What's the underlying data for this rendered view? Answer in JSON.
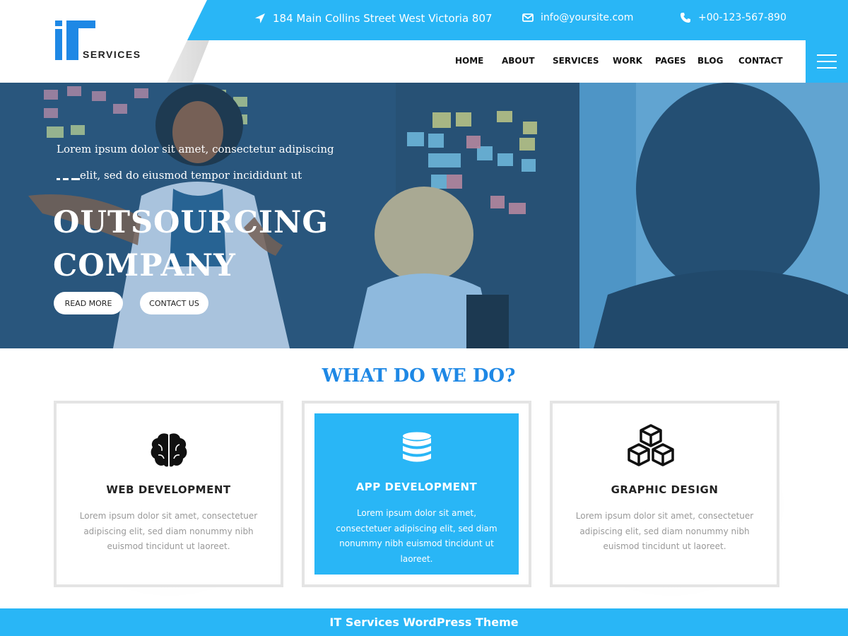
{
  "brand": {
    "logo_letters": "iT",
    "logo_text": "SERVICES"
  },
  "topbar": {
    "address": "184 Main Collins Street West Victoria 807",
    "email": "info@yoursite.com",
    "phone": "+00-123-567-890"
  },
  "nav": {
    "items": [
      "HOME",
      "ABOUT",
      "SERVICES",
      "WORK",
      "PAGES",
      "BLOG",
      "CONTACT"
    ]
  },
  "hero": {
    "subtitle_line1": "Lorem ipsum dolor sit amet, consectetur adipiscing",
    "subtitle_line2": "elit, sed do eiusmod tempor incididunt ut",
    "title_line1": "OUTSOURCING",
    "title_line2": "COMPANY",
    "read_more": "READ MORE",
    "contact_us": "CONTACT US"
  },
  "services": {
    "heading": "WHAT DO WE DO?",
    "cards": [
      {
        "icon": "brain-icon",
        "title": "WEB DEVELOPMENT",
        "text": "Lorem ipsum dolor sit amet, consectetuer adipiscing elit, sed diam nonummy nibh euismod tincidunt ut laoreet."
      },
      {
        "icon": "database-icon",
        "title": "APP DEVELOPMENT",
        "text": "Lorem ipsum dolor sit amet, consectetuer adipiscing elit, sed diam nonummy nibh euismod tincidunt ut laoreet."
      },
      {
        "icon": "cubes-icon",
        "title": "GRAPHIC DESIGN",
        "text": "Lorem ipsum dolor sit amet, consectetuer adipiscing elit, sed diam nonummy nibh euismod tincidunt ut laoreet."
      }
    ]
  },
  "footer": {
    "text": "IT Services WordPress Theme"
  },
  "colors": {
    "accent": "#29b6f6",
    "brand_blue": "#1e88e5",
    "heading_blue": "#1e88e5"
  }
}
